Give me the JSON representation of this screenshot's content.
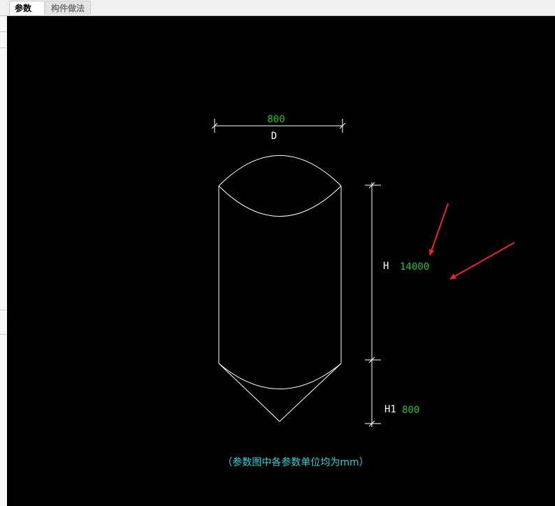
{
  "tabs": [
    {
      "label": "参数图",
      "active": true
    },
    {
      "label": "构件做法",
      "active": false
    }
  ],
  "drawing": {
    "diameter": {
      "label": "D",
      "value": "800"
    },
    "height": {
      "label": "H",
      "value": "14000"
    },
    "cone_height": {
      "label": "H1",
      "value": "800"
    },
    "note": "（参数图中各参数单位均为mm）"
  },
  "colors": {
    "background": "#000000",
    "lines": "#ffffff",
    "values": "#22c322",
    "note": "#2fd3d8",
    "arrows": "#e8262b"
  },
  "annotations": [
    "red-arrow",
    "red-arrow"
  ]
}
